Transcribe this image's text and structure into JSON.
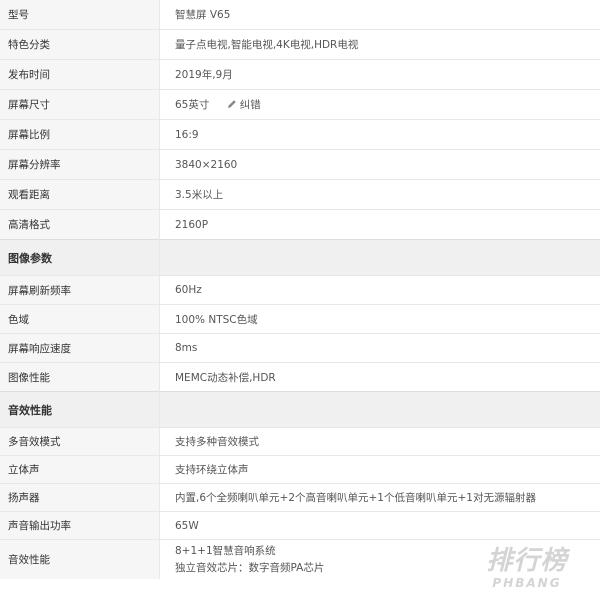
{
  "rows": [
    {
      "label": "型号",
      "value": "智慧屏 V65"
    },
    {
      "label": "特色分类",
      "value": "量子点电视,智能电视,4K电视,HDR电视"
    },
    {
      "label": "发布时间",
      "value": "2019年,9月"
    },
    {
      "label": "屏幕尺寸",
      "value": "65英寸",
      "link": "纠错"
    },
    {
      "label": "屏幕比例",
      "value": "16:9"
    },
    {
      "label": "屏幕分辨率",
      "value": "3840×2160"
    },
    {
      "label": "观看距离",
      "value": "3.5米以上"
    },
    {
      "label": "高清格式",
      "value": "2160P"
    }
  ],
  "section_image": {
    "title": "图像参数",
    "rows": [
      {
        "label": "屏幕刷新频率",
        "value": "60Hz"
      },
      {
        "label": "色域",
        "value": "100% NTSC色域"
      },
      {
        "label": "屏幕响应速度",
        "value": "8ms"
      },
      {
        "label": "图像性能",
        "value": "MEMC动态补偿,HDR"
      }
    ]
  },
  "section_audio": {
    "title": "音效性能",
    "rows": [
      {
        "label": "多音效模式",
        "value": "支持多种音效模式"
      },
      {
        "label": "立体声",
        "value": "支持环绕立体声"
      },
      {
        "label": "扬声器",
        "value": "内置,6个全频喇叭单元+2个高音喇叭单元+1个低音喇叭单元+1对无源辐射器"
      },
      {
        "label": "声音输出功率",
        "value": "65W"
      },
      {
        "label": "音效性能",
        "value_line1": "8+1+1智慧音响系统",
        "value_line2": "独立音效芯片：数字音频PA芯片"
      }
    ]
  },
  "watermark": {
    "cn": "排行榜",
    "en": "PHBANG"
  },
  "icons": {
    "correction": "pencil-icon"
  }
}
